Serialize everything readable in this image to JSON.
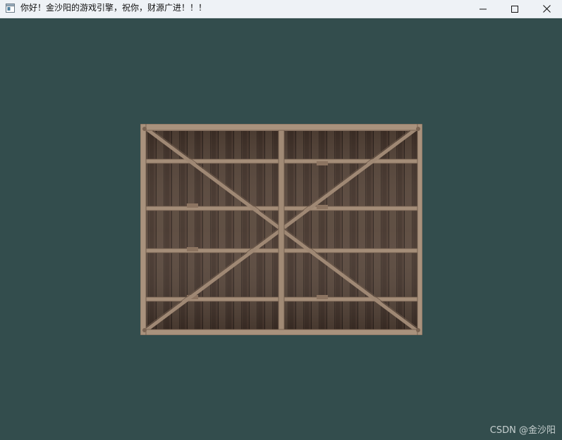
{
  "window": {
    "title": "你好！金沙阳的游戏引擎，祝你，财源广进！！！",
    "background_color": "#334d4d",
    "controls": {
      "minimize": "minimize-icon",
      "maximize": "maximize-icon",
      "close": "close-icon"
    }
  },
  "scene": {
    "object": "wooden-crate-texture"
  },
  "watermark": {
    "text": "CSDN @金沙阳"
  }
}
